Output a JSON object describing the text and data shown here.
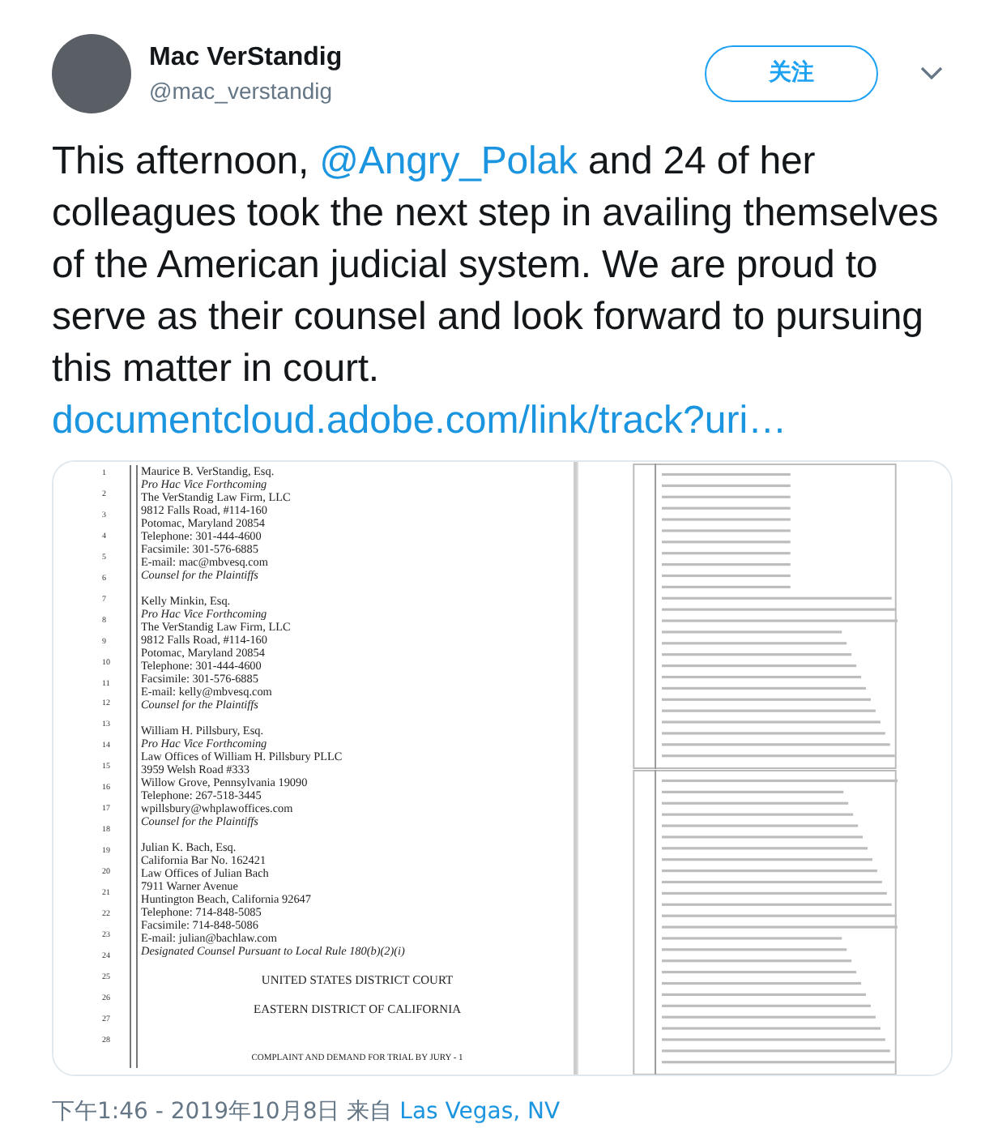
{
  "author": {
    "name": "Mac VerStandig",
    "handle": "@mac_verstandig"
  },
  "follow_button": {
    "label": "关注"
  },
  "tweet": {
    "parts": [
      {
        "kind": "text",
        "text": "This afternoon, "
      },
      {
        "kind": "mention",
        "text": "@Angry_Polak"
      },
      {
        "kind": "text",
        "text": " and 24 of her colleagues took the next step in availing themselves of the American judicial system. We are proud to serve as their counsel and look forward to pursuing this matter in court."
      }
    ],
    "link": "documentcloud.adobe.com/link/track?uri…"
  },
  "document": {
    "line_numbers": [
      "1",
      "2",
      "3",
      "4",
      "5",
      "6",
      "7",
      "8",
      "9",
      "10",
      "11",
      "12",
      "13",
      "14",
      "15",
      "16",
      "17",
      "18",
      "19",
      "20",
      "21",
      "22",
      "23",
      "24",
      "25",
      "26",
      "27",
      "28"
    ],
    "lines": [
      {
        "kind": "normal",
        "text": "Maurice B. VerStandig, Esq."
      },
      {
        "kind": "italic",
        "text": "Pro Hac Vice Forthcoming"
      },
      {
        "kind": "normal",
        "text": "The VerStandig Law Firm, LLC"
      },
      {
        "kind": "normal",
        "text": "9812 Falls Road, #114-160"
      },
      {
        "kind": "normal",
        "text": "Potomac, Maryland 20854"
      },
      {
        "kind": "normal",
        "text": "Telephone: 301-444-4600"
      },
      {
        "kind": "normal",
        "text": "Facsimile: 301-576-6885"
      },
      {
        "kind": "normal",
        "text": "E-mail: mac@mbvesq.com"
      },
      {
        "kind": "italic_end",
        "text": "Counsel for the Plaintiffs"
      },
      {
        "kind": "normal",
        "text": "Kelly Minkin, Esq."
      },
      {
        "kind": "italic",
        "text": "Pro Hac Vice Forthcoming"
      },
      {
        "kind": "normal",
        "text": "The VerStandig Law Firm, LLC"
      },
      {
        "kind": "normal",
        "text": "9812 Falls Road, #114-160"
      },
      {
        "kind": "normal",
        "text": "Potomac, Maryland 20854"
      },
      {
        "kind": "normal",
        "text": "Telephone: 301-444-4600"
      },
      {
        "kind": "normal",
        "text": "Facsimile: 301-576-6885"
      },
      {
        "kind": "normal",
        "text": "E-mail: kelly@mbvesq.com"
      },
      {
        "kind": "italic_end",
        "text": "Counsel for the Plaintiffs"
      },
      {
        "kind": "normal",
        "text": "William H. Pillsbury, Esq."
      },
      {
        "kind": "italic",
        "text": "Pro Hac Vice Forthcoming"
      },
      {
        "kind": "normal",
        "text": "Law Offices of William H. Pillsbury PLLC"
      },
      {
        "kind": "normal",
        "text": "3959 Welsh Road #333"
      },
      {
        "kind": "normal",
        "text": "Willow Grove, Pennsylvania 19090"
      },
      {
        "kind": "normal",
        "text": "Telephone: 267-518-3445"
      },
      {
        "kind": "normal",
        "text": "wpillsbury@whplawoffices.com"
      },
      {
        "kind": "italic_end",
        "text": "Counsel for the Plaintiffs"
      },
      {
        "kind": "normal",
        "text": "Julian K. Bach, Esq."
      },
      {
        "kind": "normal",
        "text": "California Bar No. 162421"
      },
      {
        "kind": "normal",
        "text": "Law Offices of Julian Bach"
      },
      {
        "kind": "normal",
        "text": "7911 Warner Avenue"
      },
      {
        "kind": "normal",
        "text": "Huntington Beach, California 92647"
      },
      {
        "kind": "normal",
        "text": "Telephone: 714-848-5085"
      },
      {
        "kind": "normal",
        "text": "Facsimile: 714-848-5086"
      },
      {
        "kind": "normal",
        "text": "E-mail: julian@bachlaw.com"
      },
      {
        "kind": "italic_end",
        "text": "Designated Counsel Pursuant to Local Rule 180(b)(2)(i)"
      },
      {
        "kind": "heading",
        "text": "UNITED STATES DISTRICT COURT"
      },
      {
        "kind": "heading",
        "text": "EASTERN DISTRICT OF CALIFORNIA"
      },
      {
        "kind": "footer",
        "text": "COMPLAINT AND DEMAND FOR TRIAL BY JURY - 1"
      }
    ]
  },
  "footer": {
    "time": "下午1:46 - 2019年10月8日 来自 ",
    "location": "Las Vegas, NV"
  }
}
